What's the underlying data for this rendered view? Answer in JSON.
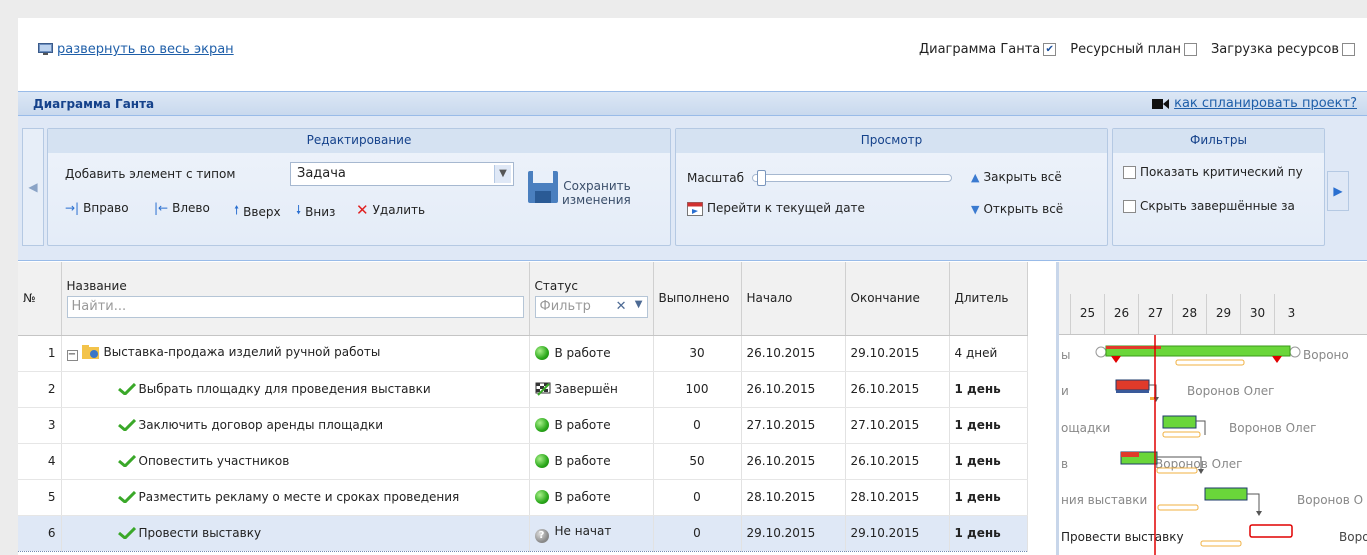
{
  "topbar": {
    "fullscreen_label": "развернуть во весь экран",
    "toggles": [
      {
        "label": "Диаграмма Ганта",
        "checked": true
      },
      {
        "label": "Ресурсный план",
        "checked": false
      },
      {
        "label": "Загрузка ресурсов",
        "checked": false
      }
    ]
  },
  "panel": {
    "title": "Диаграмма Ганта",
    "howto_label": "как спланировать проект?"
  },
  "ribbon": {
    "edit": {
      "title": "Редактирование",
      "add_type_label": "Добавить элемент с типом",
      "type_value": "Задача",
      "save_label_1": "Сохранить",
      "save_label_2": "изменения",
      "right": "Вправо",
      "left": "Влево",
      "up": "Вверх",
      "down": "Вниз",
      "delete": "Удалить"
    },
    "view": {
      "title": "Просмотр",
      "scale_label": "Масштаб",
      "goto_today": "Перейти к текущей дате",
      "collapse_all": "Закрыть всё",
      "expand_all": "Открыть всё"
    },
    "filters": {
      "title": "Фильтры",
      "critical": "Показать критический пу",
      "hide_done": "Скрыть завершённые за"
    }
  },
  "grid": {
    "headers": {
      "num": "№",
      "name": "Название",
      "status": "Статус",
      "done": "Выполнено",
      "start": "Начало",
      "end": "Окончание",
      "duration": "Длитель"
    },
    "search_placeholder": "Найти...",
    "filter_placeholder": "Фильтр",
    "rows": [
      {
        "num": "1",
        "name": "Выставка-продажа изделий ручной работы",
        "status": "В работе",
        "done": "30",
        "start": "26.10.2015",
        "end": "29.10.2015",
        "duration": "4 дней"
      },
      {
        "num": "2",
        "name": "Выбрать площадку для проведения выставки",
        "status": "Завершён",
        "done": "100",
        "start": "26.10.2015",
        "end": "26.10.2015",
        "duration": "1 день"
      },
      {
        "num": "3",
        "name": "Заключить договор аренды площадки",
        "status": "В работе",
        "done": "0",
        "start": "27.10.2015",
        "end": "27.10.2015",
        "duration": "1 день"
      },
      {
        "num": "4",
        "name": "Оповестить участников",
        "status": "В работе",
        "done": "50",
        "start": "26.10.2015",
        "end": "26.10.2015",
        "duration": "1 день"
      },
      {
        "num": "5",
        "name": "Разместить рекламу о месте и сроках проведения",
        "status": "В работе",
        "done": "0",
        "start": "28.10.2015",
        "end": "28.10.2015",
        "duration": "1 день"
      },
      {
        "num": "6",
        "name": "Провести выставку",
        "status": "Не начат",
        "done": "0",
        "start": "29.10.2015",
        "end": "29.10.2015",
        "duration": "1 день"
      }
    ]
  },
  "gantt": {
    "days": [
      "25",
      "26",
      "27",
      "28",
      "29",
      "30",
      "3"
    ],
    "labels": [
      "ы",
      "и",
      "ощадки",
      "в",
      "ния выставки",
      "Провести выставку"
    ],
    "resources": [
      "Вороно",
      "Воронов Олег",
      "Воронов Олег",
      "Воронов Олег",
      "Воронов О",
      "Воро"
    ],
    "colors": {
      "accent": "#1f5fa9",
      "bar_green": "#6ad63a",
      "bar_red": "#e03a2a",
      "today_line": "#e00000",
      "baseline": "#f0b040"
    }
  }
}
